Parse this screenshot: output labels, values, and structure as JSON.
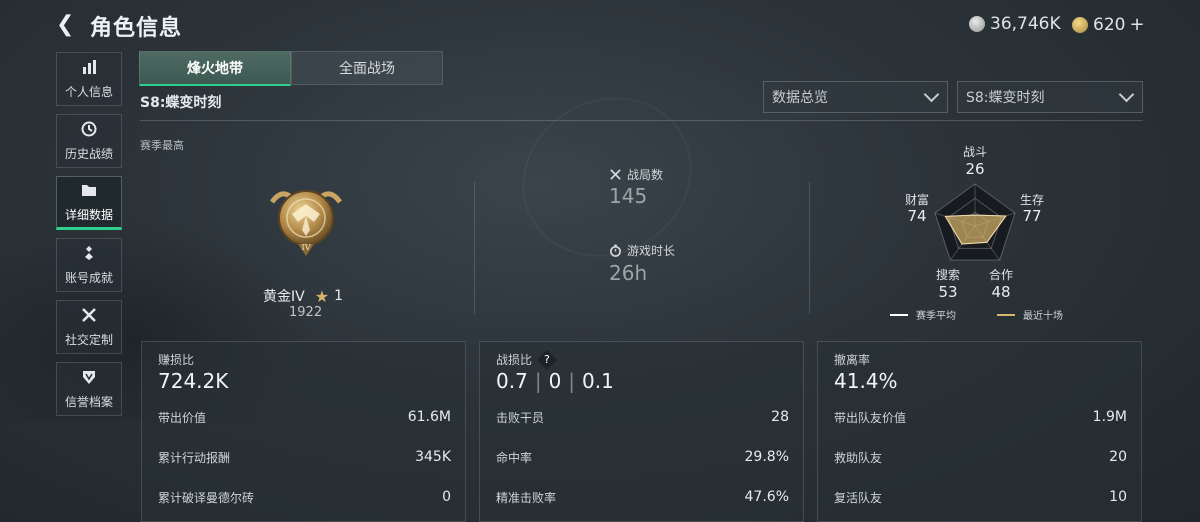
{
  "header": {
    "title": "角色信息",
    "currency_silver": "36,746K",
    "currency_gold": "620",
    "plus": "+"
  },
  "sidebar": {
    "items": [
      {
        "label": "个人信息",
        "icon": "bar-chart-icon"
      },
      {
        "label": "历史战绩",
        "icon": "clock-icon"
      },
      {
        "label": "详细数据",
        "icon": "folder-icon"
      },
      {
        "label": "账号成就",
        "icon": "medal-icon"
      },
      {
        "label": "社交定制",
        "icon": "tools-icon"
      },
      {
        "label": "信誉档案",
        "icon": "shield-icon"
      }
    ],
    "active_index": 2
  },
  "tabs": [
    {
      "label": "烽火地带",
      "active": true
    },
    {
      "label": "全面战场",
      "active": false
    }
  ],
  "season_label": "S8:蝶变时刻",
  "dropdowns": {
    "stats_select": "数据总览",
    "season_select": "S8:蝶变时刻"
  },
  "best": {
    "label": "赛季最高",
    "rank_name": "黄金IV",
    "stars": "1",
    "score": "1922"
  },
  "overview": {
    "matches_label": "战局数",
    "matches_value": "145",
    "playtime_label": "游戏时长",
    "playtime_value": "26h"
  },
  "radar": {
    "axes": [
      {
        "label": "战斗",
        "value": 26
      },
      {
        "label": "生存",
        "value": 77
      },
      {
        "label": "合作",
        "value": 48
      },
      {
        "label": "搜索",
        "value": 53
      },
      {
        "label": "财富",
        "value": 74
      }
    ],
    "legend_season": "赛季平均",
    "legend_recent": "最近十场",
    "colors": {
      "season": "#ffffff",
      "recent": "#d8b36a"
    }
  },
  "cards": [
    {
      "title": "赚损比",
      "big": "724.2K",
      "rows": [
        {
          "label": "带出价值",
          "value": "61.6M"
        },
        {
          "label": "累计行动报酬",
          "value": "345K"
        },
        {
          "label": "累计破译曼德尔砖",
          "value": "0"
        }
      ]
    },
    {
      "title": "战损比",
      "help": "?",
      "big_parts": [
        "0.7",
        "0",
        "0.1"
      ],
      "rows": [
        {
          "label": "击败干员",
          "value": "28"
        },
        {
          "label": "命中率",
          "value": "29.8%"
        },
        {
          "label": "精准击败率",
          "value": "47.6%"
        }
      ]
    },
    {
      "title": "撤离率",
      "big": "41.4%",
      "rows": [
        {
          "label": "带出队友价值",
          "value": "1.9M"
        },
        {
          "label": "救助队友",
          "value": "20"
        },
        {
          "label": "复活队友",
          "value": "10"
        }
      ]
    }
  ]
}
